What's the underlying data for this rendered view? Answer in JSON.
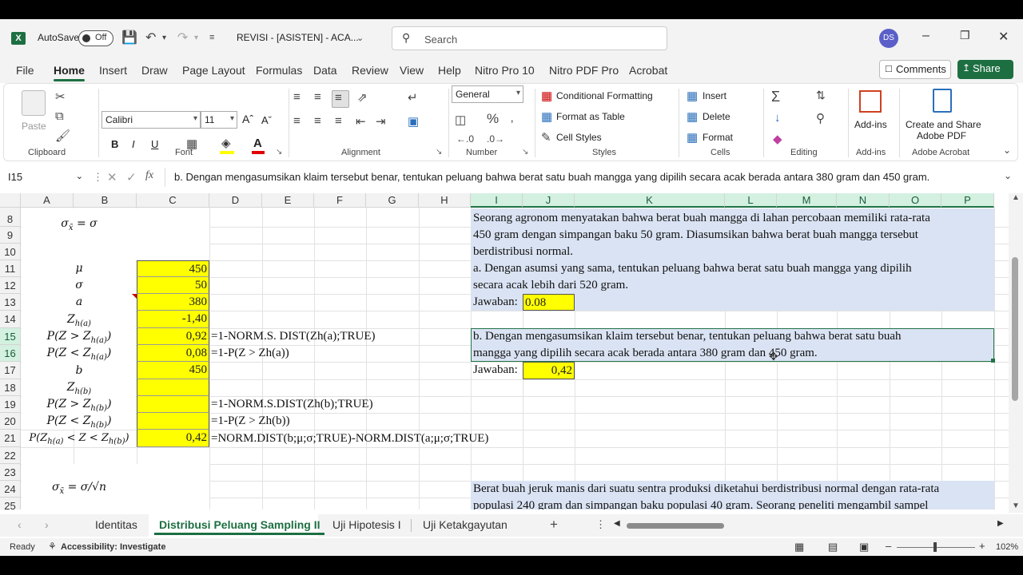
{
  "titlebar": {
    "autosave_label": "AutoSave",
    "autosave_state": "Off",
    "doc_title": "REVISI - [ASISTEN] - ACA...",
    "search_placeholder": "Search",
    "user_initials": "DS"
  },
  "menu": {
    "file": "File",
    "home": "Home",
    "insert": "Insert",
    "draw": "Draw",
    "page_layout": "Page Layout",
    "formulas": "Formulas",
    "data": "Data",
    "review": "Review",
    "view": "View",
    "help": "Help",
    "nitro_pro": "Nitro Pro 10",
    "nitro_pdf": "Nitro PDF Pro",
    "acrobat": "Acrobat",
    "comments": "Comments",
    "share": "Share"
  },
  "ribbon": {
    "clipboard": {
      "paste": "Paste",
      "label": "Clipboard"
    },
    "font": {
      "name": "Calibri",
      "size": "11",
      "label": "Font",
      "bold": "B",
      "italic": "I",
      "underline": "U"
    },
    "alignment": {
      "label": "Alignment"
    },
    "number": {
      "format": "General",
      "label": "Number"
    },
    "styles": {
      "conditional": "Conditional Formatting",
      "format_table": "Format as Table",
      "cell_styles": "Cell Styles",
      "label": "Styles"
    },
    "cells": {
      "insert": "Insert",
      "delete": "Delete",
      "format": "Format",
      "label": "Cells"
    },
    "editing": {
      "label": "Editing"
    },
    "addins": {
      "button": "Add-ins",
      "label": "Add-ins"
    },
    "acrobat": {
      "button_line1": "Create and Share",
      "button_line2": "Adobe PDF",
      "label": "Adobe Acrobat"
    }
  },
  "formula_bar": {
    "name_box": "I15",
    "content": "b. Dengan mengasumsikan klaim tersebut benar, tentukan peluang bahwa berat satu buah mangga yang dipilih secara acak berada antara 380 gram dan 450 gram."
  },
  "grid": {
    "columns": [
      "A",
      "B",
      "C",
      "D",
      "E",
      "F",
      "G",
      "H",
      "I",
      "J",
      "K",
      "L",
      "M",
      "N",
      "O",
      "P"
    ],
    "rows": [
      "8",
      "9",
      "10",
      "11",
      "12",
      "13",
      "14",
      "15",
      "16",
      "17",
      "18",
      "19",
      "20",
      "21",
      "22",
      "23",
      "24",
      "25"
    ],
    "values": {
      "c11": "450",
      "c12": "50",
      "c13": "380",
      "c14": "-1,40",
      "c15": "0,92",
      "c16": "0,08",
      "c17": "450",
      "c21": "0,42"
    },
    "formulas": {
      "d15": "=1-NORM.S. DIST(Zh(a);TRUE)",
      "d16": "=1-P(Z > Zh(a))",
      "d19": "=1-NORM.S.DIST(Zh(b);TRUE)",
      "d20": "=1-P(Z > Zh(b))",
      "d21": "=NORM.DIST(b;μ;σ;TRUE)-NORM.DIST(a;μ;σ;TRUE)"
    },
    "problem": {
      "l1": "Seorang agronom menyatakan bahwa berat buah mangga di lahan percobaan memiliki rata-rata",
      "l2": "450 gram dengan simpangan baku 50 gram. Diasumsikan bahwa berat buah mangga tersebut",
      "l3": "berdistribusi normal.",
      "l4": "a. Dengan asumsi yang sama, tentukan peluang bahwa berat satu buah mangga yang dipilih",
      "l5": "secara acak lebih dari 520 gram.",
      "jawaban_a_label": "Jawaban:",
      "jawaban_a": "0.08",
      "b1": "b. Dengan mengasumsikan klaim tersebut benar, tentukan peluang bahwa berat satu buah",
      "b2": "mangga yang dipilih secara acak berada antara 380 gram dan 450 gram.",
      "jawaban_b_label": "Jawaban:",
      "jawaban_b": "0,42",
      "c1": "Berat buah jeruk manis dari suatu sentra produksi diketahui berdistribusi normal dengan rata-rata",
      "c2": "populasi 240 gram dan simpangan baku populasi 40 gram. Seorang peneliti mengambil sampel"
    }
  },
  "sheets": [
    "Identitas",
    "Distribusi Peluang Sampling II",
    "Uji Hipotesis I",
    "Uji Ketakgayutan"
  ],
  "status": {
    "ready": "Ready",
    "accessibility": "Accessibility: Investigate",
    "zoom": "102%"
  },
  "colors": {
    "excel_green": "#1d6f42",
    "highlight_yellow": "#ffff00",
    "problem_blue": "#dae3f3"
  }
}
